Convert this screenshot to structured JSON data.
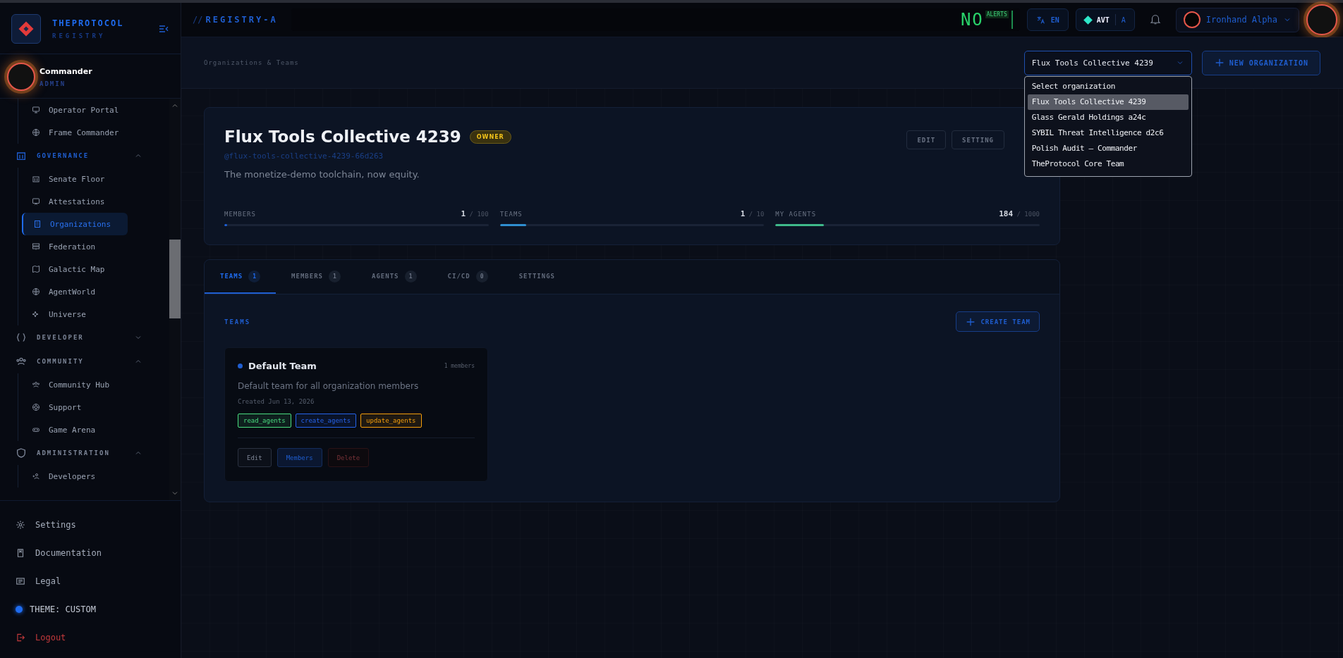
{
  "sidebar": {
    "brand": {
      "title": "THEPROTOCOL",
      "subtitle": "REGISTRY"
    },
    "user": {
      "name": "Commander",
      "role": "ADMIN"
    },
    "nav": [
      {
        "kind": "continued",
        "children": [
          {
            "label": "Operator Portal",
            "selected": false
          },
          {
            "label": "Frame Commander",
            "selected": false
          }
        ]
      },
      {
        "kind": "section",
        "label": "GOVERNANCE",
        "expanded": true,
        "active": true,
        "children": [
          {
            "label": "Senate Floor",
            "selected": false
          },
          {
            "label": "Attestations",
            "selected": false
          },
          {
            "label": "Organizations",
            "selected": true
          },
          {
            "label": "Federation",
            "selected": false
          },
          {
            "label": "Galactic Map",
            "selected": false
          },
          {
            "label": "AgentWorld",
            "selected": false
          },
          {
            "label": "Universe",
            "selected": false
          }
        ]
      },
      {
        "kind": "section",
        "label": "DEVELOPER",
        "expanded": false,
        "active": false
      },
      {
        "kind": "section",
        "label": "COMMUNITY",
        "expanded": true,
        "active": false,
        "children": [
          {
            "label": "Community Hub",
            "selected": false
          },
          {
            "label": "Support",
            "selected": false
          },
          {
            "label": "Game Arena",
            "selected": false
          }
        ]
      },
      {
        "kind": "section",
        "label": "ADMINISTRATION",
        "expanded": true,
        "active": false,
        "children": [
          {
            "label": "Developers",
            "selected": false
          }
        ]
      }
    ],
    "footer": [
      {
        "kind": "link",
        "label": "Settings"
      },
      {
        "kind": "link",
        "label": "Documentation"
      },
      {
        "kind": "link",
        "label": "Legal"
      },
      {
        "kind": "theme",
        "label": "THEME: CUSTOM"
      },
      {
        "kind": "logout",
        "label": "Logout"
      }
    ]
  },
  "top_bar": {
    "prefix": "//",
    "title": "REGISTRY-A",
    "alerts": {
      "value": "NO",
      "label": "ALERTS"
    },
    "language": "EN",
    "token": {
      "symbol": "AVT",
      "suffix": "A"
    },
    "user": "Ironhand Alpha"
  },
  "header": {
    "breadcrumb": "Organizations & Teams",
    "select": {
      "value": "Flux Tools Collective 4239",
      "expanded": true,
      "options": [
        {
          "label": "Select organization",
          "selected": false
        },
        {
          "label": "Flux Tools Collective 4239",
          "selected": true
        },
        {
          "label": "Glass Gerald Holdings a24c",
          "selected": false
        },
        {
          "label": "SYBIL Threat Intelligence d2c6",
          "selected": false
        },
        {
          "label": "Polish Audit — Commander",
          "selected": false
        },
        {
          "label": "TheProtocol Core Team",
          "selected": false
        }
      ]
    },
    "new_button": "NEW ORGANIZATION"
  },
  "organization": {
    "name": "Flux Tools Collective 4239",
    "badge": "OWNER",
    "handle": "@flux-tools-collective-4239-66d263",
    "description": "The monetize-demo toolchain, now equity.",
    "buttons": [
      "EDIT",
      "SETTING"
    ],
    "stats": [
      {
        "label": "MEMBERS",
        "value": "1",
        "max": "/ 100",
        "level": 0.01,
        "color": "#1d5fd6"
      },
      {
        "label": "TEAMS",
        "value": "1",
        "max": "/ 10",
        "level": 0.1,
        "color": "#2f8fd0"
      },
      {
        "label": "MY AGENTS",
        "value": "184",
        "max": "/ 1000",
        "level": 0.184,
        "color": "#3fb98a"
      }
    ]
  },
  "tabs": [
    {
      "label": "TEAMS",
      "count": "1",
      "selected": true
    },
    {
      "label": "MEMBERS",
      "count": "1",
      "selected": false
    },
    {
      "label": "AGENTS",
      "count": "1",
      "selected": false
    },
    {
      "label": "CI/CD",
      "count": "0",
      "selected": false
    },
    {
      "label": "SETTINGS",
      "selected": false
    }
  ],
  "teams_section": {
    "title": "TEAMS",
    "create_button": "CREATE TEAM",
    "teams": [
      {
        "name": "Default Team",
        "members": "1 members",
        "description": "Default team for all organization members",
        "created": "Created Jun 13, 2026",
        "permissions": [
          {
            "label": "read_agents",
            "color": "#4ade80"
          },
          {
            "label": "create_agents",
            "color": "#2563eb"
          },
          {
            "label": "update_agents",
            "color": "#f59e0b"
          }
        ],
        "actions": [
          {
            "label": "Edit",
            "kind": "neutral"
          },
          {
            "label": "Members",
            "kind": "primary"
          },
          {
            "label": "Delete",
            "kind": "danger",
            "disabled": true
          }
        ]
      }
    ]
  }
}
